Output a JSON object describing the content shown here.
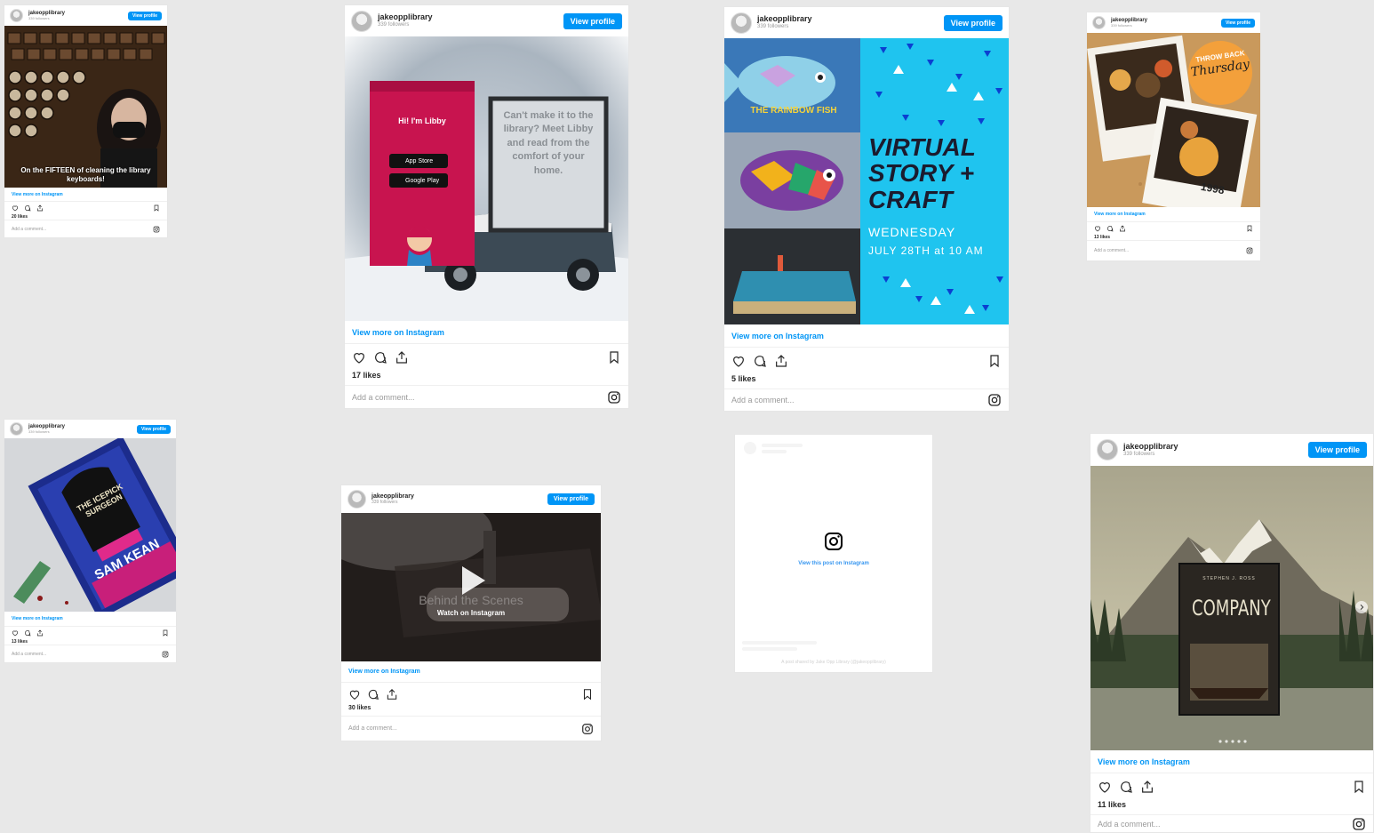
{
  "colors": {
    "accent": "#0095f6",
    "background": "#e8e8e8"
  },
  "posts": [
    {
      "username": "jakeopplibrary",
      "followers": "339 followers",
      "view_profile": "View profile",
      "view_more": "View more on Instagram",
      "likes": "20 likes",
      "add_comment": "Add a comment...",
      "media_text": "On the FIFTEEN of cleaning the library keyboards!"
    },
    {
      "username": "jakeopplibrary",
      "followers": "339 followers",
      "view_profile": "View profile",
      "view_more": "View more on Instagram",
      "likes": "17 likes",
      "add_comment": "Add a comment...",
      "media_text": "Can't make it to the library? Meet Libby and read from the comfort of your home.",
      "app_banner": "Hi! I'm Libby",
      "app_store": "App Store",
      "google_play": "Google Play"
    },
    {
      "username": "jakeopplibrary",
      "followers": "339 followers",
      "view_profile": "View profile",
      "view_more": "View more on Instagram",
      "likes": "5 likes",
      "add_comment": "Add a comment...",
      "book_title": "THE RAINBOW FISH",
      "event_title": "VIRTUAL STORY + CRAFT",
      "event_day": "WEDNESDAY",
      "event_time": "JULY 28TH at 10 AM"
    },
    {
      "username": "jakeopplibrary",
      "followers": "339 followers",
      "view_profile": "View profile",
      "view_more": "View more on Instagram",
      "likes": "13 likes",
      "add_comment": "Add a comment...",
      "badge_line1": "THROW BACK",
      "badge_line2": "Thursday",
      "photo_year": "1998"
    },
    {
      "username": "jakeopplibrary",
      "followers": "339 followers",
      "view_profile": "View profile",
      "view_more": "View more on Instagram",
      "likes": "13 likes",
      "add_comment": "Add a comment...",
      "book_title": "THE ICEPICK SURGEON",
      "book_author": "SAM KEAN"
    },
    {
      "username": "jakeopplibrary",
      "followers": "339 followers",
      "view_profile": "View profile",
      "view_more": "View more on Instagram",
      "likes": "30 likes",
      "add_comment": "Add a comment...",
      "video_title": "Behind the Scenes",
      "watch_label": "Watch on Instagram"
    },
    {
      "placeholder_link": "View this post on Instagram",
      "placeholder_caption": "A post shared by Jake Opp Library (@jakeopplibrary)"
    },
    {
      "username": "jakeopplibrary",
      "followers": "339 followers",
      "view_profile": "View profile",
      "view_more": "View more on Instagram",
      "likes": "11 likes",
      "add_comment": "Add a comment...",
      "book_author": "STEPHEN J. ROSS",
      "book_title": "COMPANY"
    }
  ]
}
